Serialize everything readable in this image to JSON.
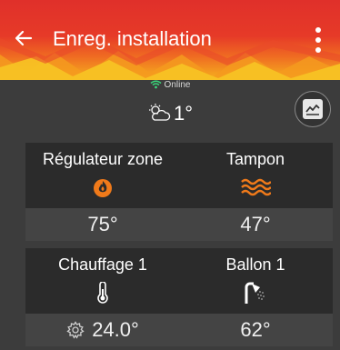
{
  "header": {
    "title": "Enreg. installation",
    "back_icon": "arrow-left-icon",
    "menu_icon": "more-vert-icon"
  },
  "status": {
    "text": "Online",
    "icon": "wifi-icon",
    "color": "#3ad47a"
  },
  "weather": {
    "icon": "partly-cloudy-icon",
    "temperature": "1°"
  },
  "chart_button": {
    "icon": "trend-chart-icon"
  },
  "tiles": [
    {
      "name": "Régulateur zone",
      "icon": "flame-icon",
      "value": "75°"
    },
    {
      "name": "Tampon",
      "icon": "waves-icon",
      "value": "47°"
    },
    {
      "name": "Chauffage 1",
      "icon": "thermometer-icon",
      "sub_icon": "gear-icon",
      "value": "24.0°"
    },
    {
      "name": "Ballon 1",
      "icon": "shower-icon",
      "value": "62°"
    }
  ],
  "colors": {
    "accent_red": "#e0302a",
    "accent_orange": "#f07a1a",
    "background": "#3c3c3c"
  }
}
